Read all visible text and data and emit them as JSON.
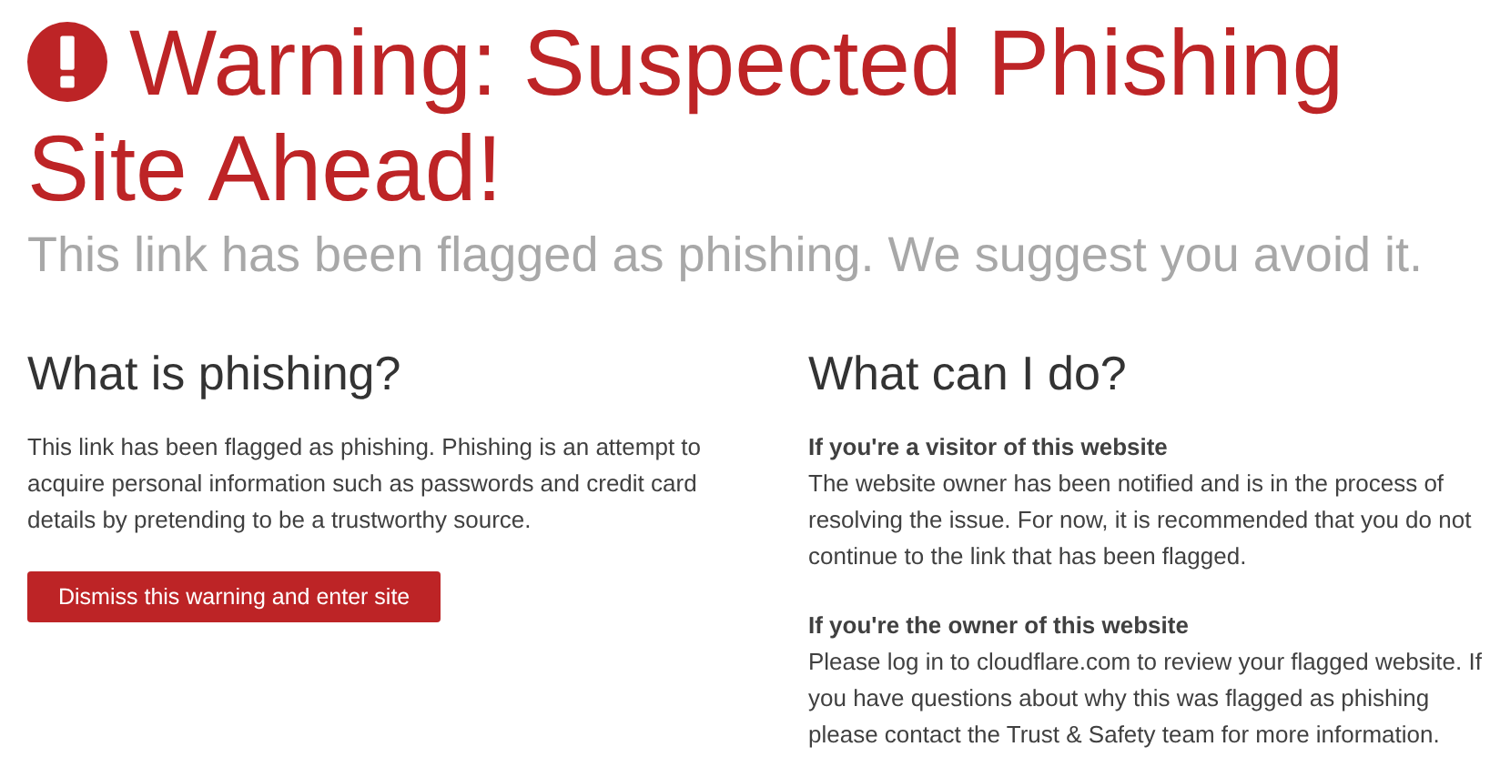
{
  "header": {
    "title": "Warning: Suspected Phishing Site Ahead!",
    "subtitle": "This link has been flagged as phishing. We suggest you avoid it."
  },
  "left": {
    "heading": "What is phishing?",
    "text": "This link has been flagged as phishing. Phishing is an attempt to acquire personal information such as passwords and credit card details by pretending to be a trustworthy source.",
    "button": "Dismiss this warning and enter site"
  },
  "right": {
    "heading": "What can I do?",
    "sections": [
      {
        "title": "If you're a visitor of this website",
        "text": "The website owner has been notified and is in the process of resolving the issue. For now, it is recommended that you do not continue to the link that has been flagged."
      },
      {
        "title": "If you're the owner of this website",
        "text": "Please log in to cloudflare.com to review your flagged website. If you have questions about why this was flagged as phishing please contact the Trust & Safety team for more information."
      }
    ]
  }
}
